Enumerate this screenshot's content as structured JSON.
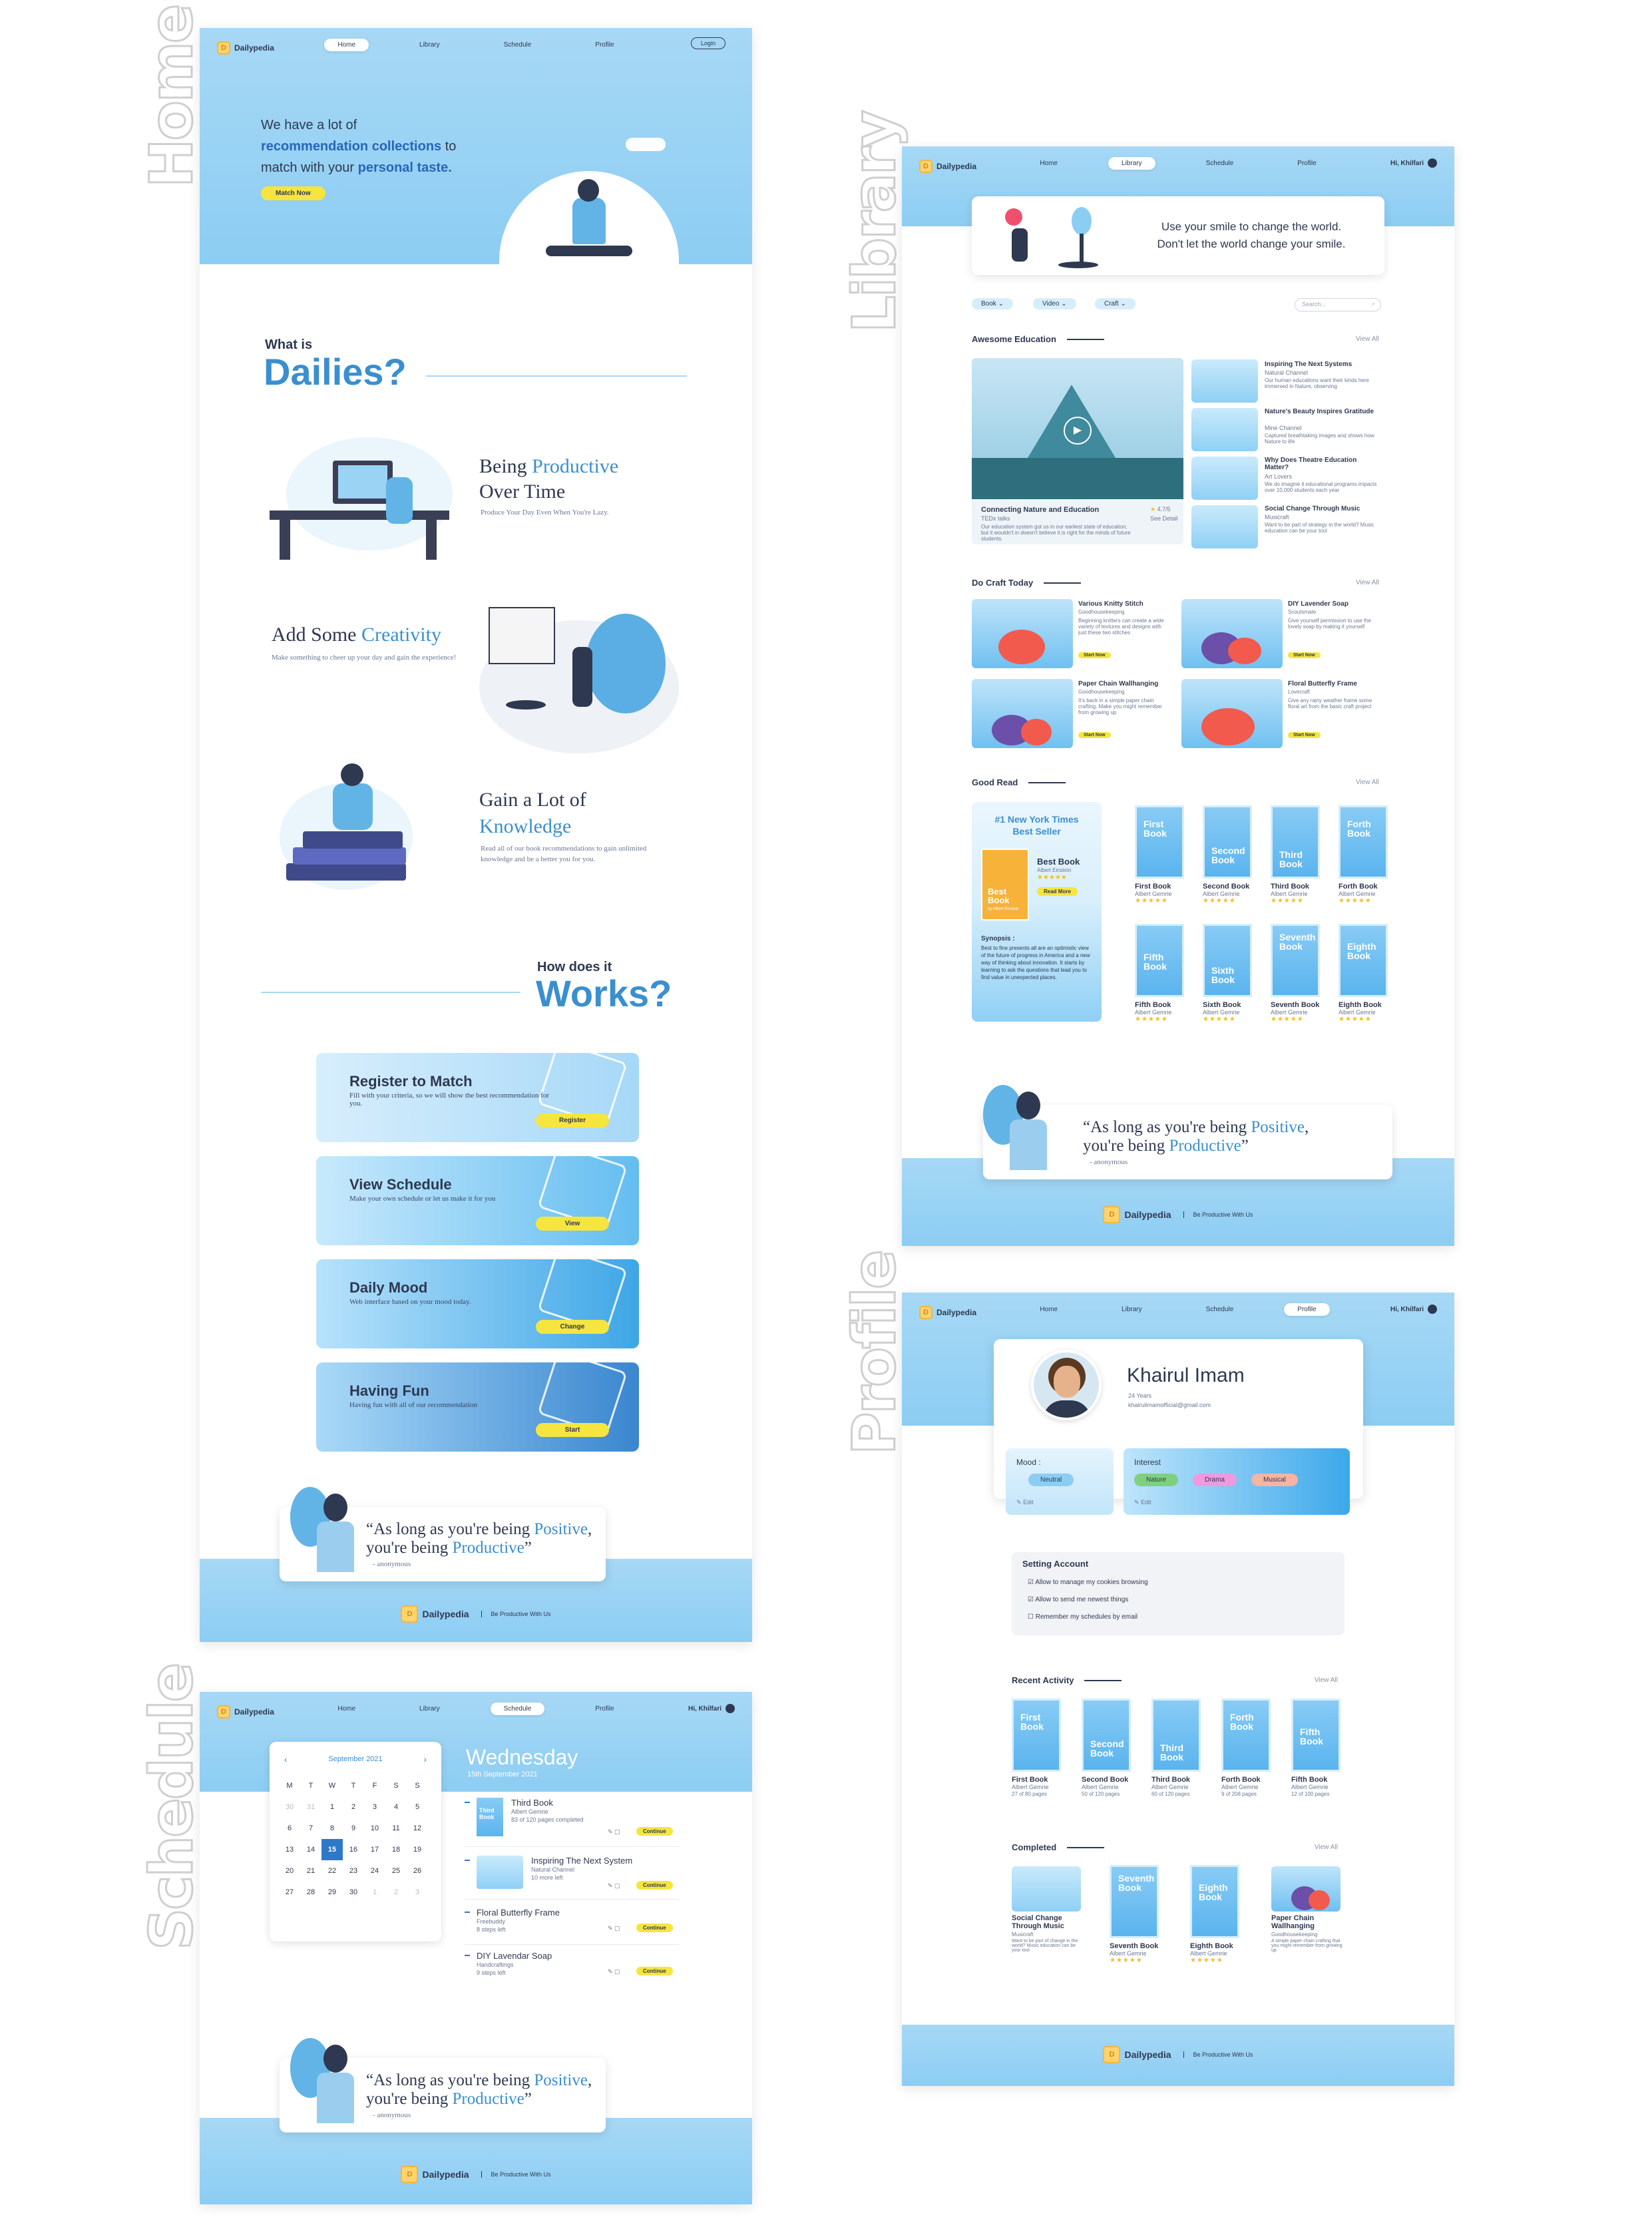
{
  "labels": {
    "home": "Home",
    "library": "Library",
    "schedule": "Schedule",
    "profile": "Profile"
  },
  "nav": {
    "items": [
      "Home",
      "Library",
      "Schedule",
      "Profile"
    ],
    "login": "Login",
    "user": "Hi, Khilfari"
  },
  "brand": {
    "name": "Dailypedia",
    "tagline": "Be Productive With Us"
  },
  "home": {
    "hero": {
      "line1": "We have a lot of",
      "hl1": "recommendation collections",
      "line2a": " to",
      "line3a": "match with your ",
      "hl2": "personal taste.",
      "cta": "Match Now"
    },
    "what": {
      "small": "What is",
      "big": "Dailies?"
    },
    "features": [
      {
        "t1": "Being ",
        "t2": "Productive",
        "t3": "Over Time",
        "desc": "Produce Your Day Even When You're Lazy."
      },
      {
        "t1": "Add Some ",
        "t2": "Creativity",
        "t3": "",
        "desc": "Make something to cheer up your day and gain the experience!"
      },
      {
        "t1": "Gain a Lot of",
        "t2": "Knowledge",
        "t3": "",
        "desc": "Read all of our book recommendations to gain unlimited knowledge and be a better you for you."
      }
    ],
    "how": {
      "small": "How does it",
      "big": "Works?"
    },
    "cards": [
      {
        "title": "Register to Match",
        "desc": "Fill with your criteria, so we will show the best recommendation for you.",
        "btn": "Register"
      },
      {
        "title": "View Schedule",
        "desc": "Make your own schedule or let us make it for you",
        "btn": "View"
      },
      {
        "title": "Daily Mood",
        "desc": "Web interface based on your mood today.",
        "btn": "Change"
      },
      {
        "title": "Having Fun",
        "desc": "Having fun with all of our recommendation",
        "btn": "Start"
      }
    ]
  },
  "quote": {
    "a": "“As long as you're being ",
    "pos": "Positive",
    "b": ",",
    "c": "you're being ",
    "prod": "Productive",
    "d": "”",
    "anon": "- anonymous"
  },
  "library": {
    "hero": {
      "l1": "Use your smile to change the world.",
      "l2": "Don't let the world change your smile."
    },
    "filters": [
      "Book",
      "Video",
      "Craft"
    ],
    "search": "Search...",
    "viewall": "View All",
    "edu": {
      "title": "Awesome Education",
      "main": {
        "title": "Connecting Nature and Education",
        "src": "TEDx talks",
        "rating": "4.7/5",
        "see": "See Detail",
        "desc": "Our education system got us in our earliest state of education, but it wouldn't in doesn't believe it is right for the minds of future students.",
        "time": "4:47"
      },
      "items": [
        {
          "title": "Inspiring The Next Systems",
          "src": "Natural Channel",
          "desc": "Our human educations want their kinds here immersed in Nature, observing"
        },
        {
          "title": "Nature's Beauty Inspires Gratitude",
          "src": "Mine Channel",
          "desc": "Captured breathtaking images and shows how Nature to life"
        },
        {
          "title": "Why Does Theatre Education Matter?",
          "src": "Art Lovers",
          "desc": "We do imagine it educational programs impacts over 10,000 students each year"
        },
        {
          "title": "Social Change Through Music",
          "src": "Musicraft",
          "desc": "Want to be part of strategy in the world? Music education can be your tool"
        }
      ]
    },
    "craft": {
      "title": "Do Craft Today",
      "btn": "Start Now",
      "items": [
        {
          "title": "Various Knitty Stitch",
          "src": "Goodhousekeeping",
          "desc": "Beginning knitters can create a wide variety of textures and designs with just these two stitches"
        },
        {
          "title": "DIY Lavender Soap",
          "src": "Scoutsmate",
          "desc": "Give yourself permission to use the lovely soap by making it yourself"
        },
        {
          "title": "Paper Chain Wallhanging",
          "src": "Goodhousekeeping",
          "desc": "It's back in a simple paper chain crafting. Make you might remember from growing up"
        },
        {
          "title": "Floral Butterfly Frame",
          "src": "Lovecraft",
          "desc": "Give any rainy weather frame some floral art from the basic craft project"
        }
      ]
    },
    "read": {
      "title": "Good Read",
      "best": {
        "l1": "#1 New York Times",
        "l2": "Best Seller",
        "book": "Best Book",
        "auth": "Albert Einstein",
        "cover": "Best Book",
        "sub": "by Albert Einstein",
        "btn": "Read More",
        "syn": "Synopsis :",
        "syntext": "Best to fine presents all are an optimistic view of the future of progress in America and a new way of thinking about innovation. It starts by learning to ask the questions that lead you to find value in unexpected places."
      },
      "books": [
        {
          "cover": "First Book",
          "title": "First Book",
          "auth": "Albert Gemrie"
        },
        {
          "cover": "Second Book",
          "title": "Second Book",
          "auth": "Albert Gemrie"
        },
        {
          "cover": "Third Book",
          "title": "Third Book",
          "auth": "Albert Gemrie"
        },
        {
          "cover": "Forth Book",
          "title": "Forth Book",
          "auth": "Albert Gemrie"
        },
        {
          "cover": "Fifth Book",
          "title": "Fifth Book",
          "auth": "Albert Gemrie"
        },
        {
          "cover": "Sixth Book",
          "title": "Sixth Book",
          "auth": "Albert Gemrie"
        },
        {
          "cover": "Seventh Book",
          "title": "Seventh Book",
          "auth": "Albert Gemrie"
        },
        {
          "cover": "Eighth Book",
          "title": "Eighth Book",
          "auth": "Albert Gemrie"
        }
      ]
    }
  },
  "schedule": {
    "month": "September 2021",
    "weekdays": [
      "M",
      "T",
      "W",
      "T",
      "F",
      "S",
      "S"
    ],
    "weeks": [
      [
        "30",
        "31",
        "1",
        "2",
        "3",
        "4",
        "5"
      ],
      [
        "6",
        "7",
        "8",
        "9",
        "10",
        "11",
        "12"
      ],
      [
        "13",
        "14",
        "15",
        "16",
        "17",
        "18",
        "19"
      ],
      [
        "20",
        "21",
        "22",
        "23",
        "24",
        "25",
        "26"
      ],
      [
        "27",
        "28",
        "29",
        "30",
        "1",
        "2",
        "3"
      ]
    ],
    "day": "Wednesday",
    "date": "15th September 2021",
    "btn": "Continue",
    "items": [
      {
        "title": "Third Book",
        "src": "Albert Gemrie",
        "desc": "83 of 120 pages completed",
        "cover": "Third Book"
      },
      {
        "title": "Inspiring The Next System",
        "src": "Natural Channel",
        "desc": "10 more left"
      },
      {
        "title": "Floral Butterfly Frame",
        "src": "Freebuddy",
        "desc": "8 steps left"
      },
      {
        "title": "DIY Lavendar Soap",
        "src": "Handcraftings",
        "desc": "9 steps left"
      }
    ]
  },
  "profile": {
    "name": "Khairul Imam",
    "age": "24 Years",
    "email": "khairulimamofficial@gmail.com",
    "mood": {
      "label": "Mood :",
      "value": "Neutral",
      "edit": "Edit"
    },
    "interest": {
      "label": "Interest",
      "tags": [
        "Nature",
        "Drama",
        "Musical"
      ],
      "edit": "Edit"
    },
    "settings": {
      "title": "Setting Account",
      "items": [
        "Allow to manage my cookies browsing",
        "Allow to send me newest things",
        "Remember my schedules by email"
      ]
    },
    "recent": {
      "title": "Recent Activity",
      "viewall": "View All",
      "items": [
        {
          "cover": "First Book",
          "title": "First Book",
          "auth": "Albert Gemrie",
          "p": "27 of 80 pages"
        },
        {
          "cover": "Second Book",
          "title": "Second Book",
          "auth": "Albert Gemrie",
          "p": "50 of 120 pages"
        },
        {
          "cover": "Third Book",
          "title": "Third Book",
          "auth": "Albert Gemrie",
          "p": "60 of 120 pages"
        },
        {
          "cover": "Forth Book",
          "title": "Forth Book",
          "auth": "Albert Gemrie",
          "p": "9 of 208 pages"
        },
        {
          "cover": "Fifth Book",
          "title": "Fifth Book",
          "auth": "Albert Gemrie",
          "p": "12 of 100 pages"
        }
      ]
    },
    "completed": {
      "title": "Completed",
      "viewall": "View All",
      "items": [
        {
          "cover": "",
          "title": "Social Change Through Music",
          "auth": "Musicraft",
          "p": "Want to be part of change in the world? Music education can be your tool"
        },
        {
          "cover": "Seventh Book",
          "title": "Seventh Book",
          "auth": "Albert Gemrie",
          "p": ""
        },
        {
          "cover": "Eighth Book",
          "title": "Eighth Book",
          "auth": "Albert Gemrie",
          "p": ""
        },
        {
          "cover": "",
          "title": "Paper Chain Wallhanging",
          "auth": "Goodhousekeeping",
          "p": "A simple paper chain crafting that you might remember from growing up"
        }
      ]
    }
  },
  "colors": {
    "accent": "#3a8fcf",
    "hero": "#a7d8f5",
    "button": "#f6e53f",
    "star": "#f3be25"
  }
}
